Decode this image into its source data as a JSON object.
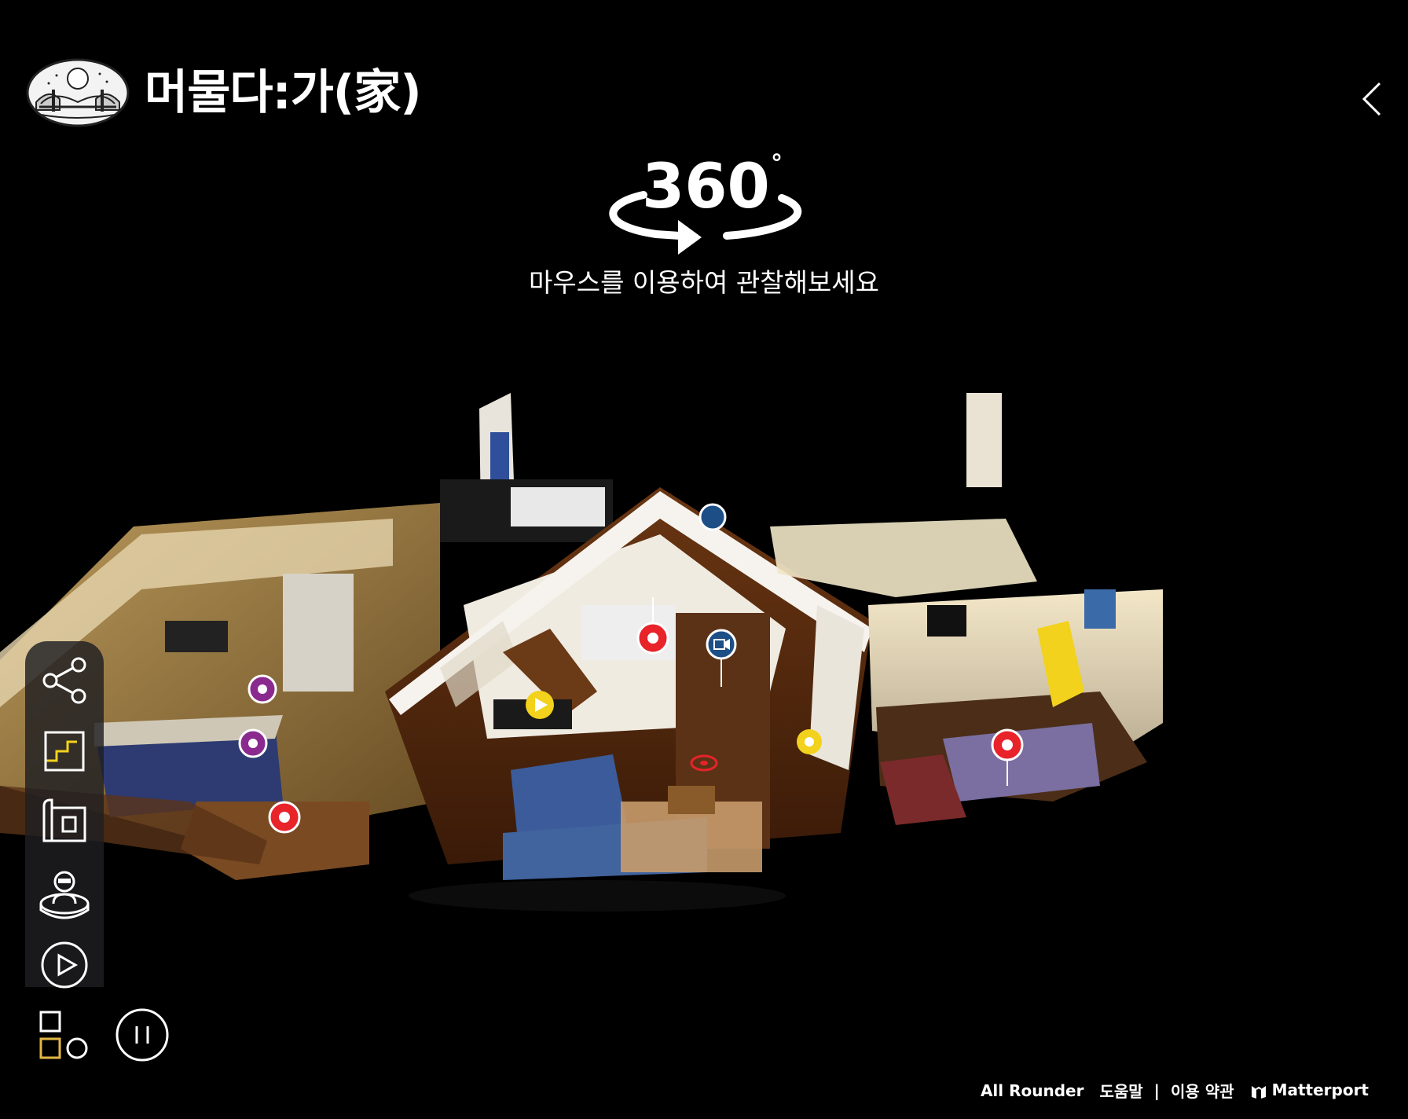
{
  "header": {
    "brand_title": "머물다:가(家)"
  },
  "instruction": {
    "degrees": "360",
    "degree_symbol": "°",
    "hint": "마우스를 이용하여 관찰해보세요"
  },
  "toolbar": {
    "items": [
      {
        "icon": "share-icon"
      },
      {
        "icon": "floor-stairs-icon"
      },
      {
        "icon": "floorplan-icon"
      },
      {
        "icon": "inside-view-icon"
      },
      {
        "icon": "play-tour-icon"
      },
      {
        "icon": "shapes-icon"
      }
    ],
    "pause_icon": "pause-icon"
  },
  "tags": {
    "colors": {
      "red": "#e8232a",
      "purple": "#8a2a8e",
      "yellow": "#f2d21c",
      "blue": "#1d4f86"
    }
  },
  "footer": {
    "credit": "All Rounder",
    "help": "도움말",
    "separator": "|",
    "terms": "이용 약관",
    "brand": "Matterport"
  }
}
